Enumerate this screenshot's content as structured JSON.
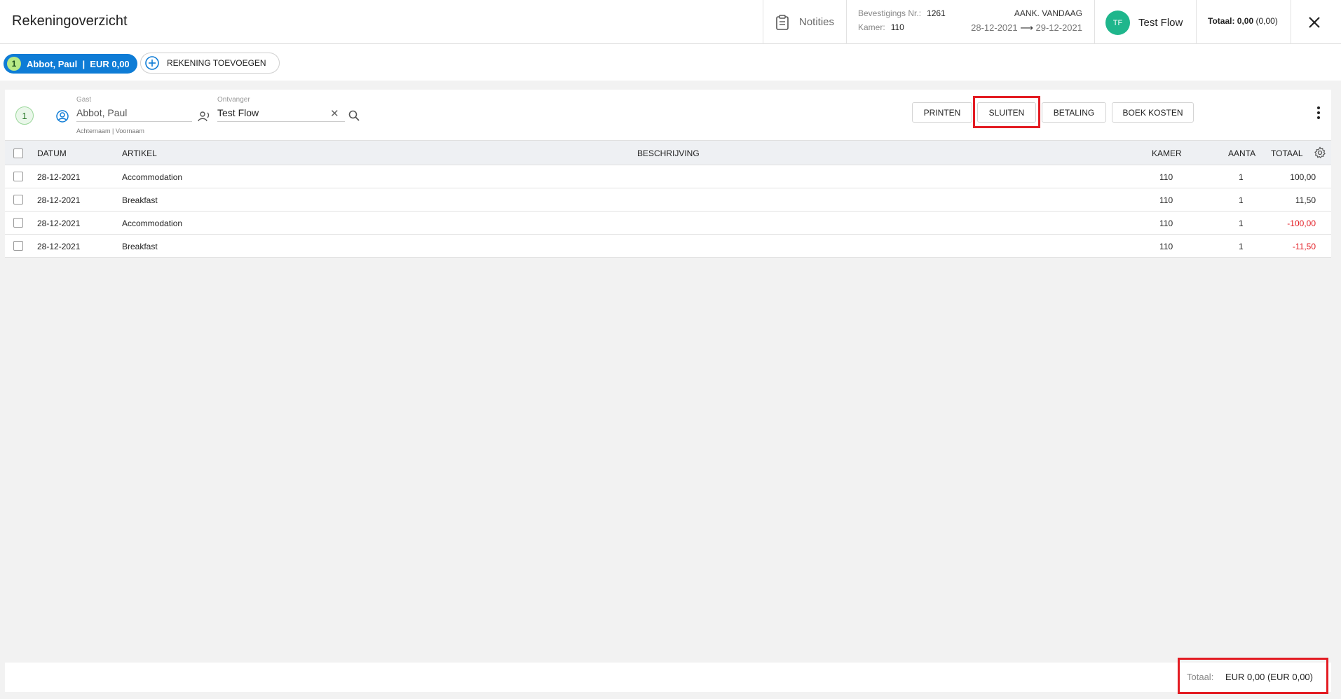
{
  "header": {
    "title": "Rekeningoverzicht",
    "notes_label": "Notities",
    "booking_label": "Bevestigings Nr.:",
    "booking_number": "1261",
    "room_label": "Kamer:",
    "room_number": "110",
    "arrival_status": "AANK. VANDAAG",
    "date_from": "28-12-2021",
    "date_arrow": "⟶",
    "date_to": "29-12-2021",
    "user_initials": "TF",
    "user_name": "Test Flow",
    "total_label": "Totaal:",
    "total_value": "0,00",
    "total_secondary": "(0,00)"
  },
  "accounts": {
    "active": {
      "number": "1",
      "label": "Abbot, Paul  |  EUR 0,00"
    },
    "add_label": "REKENING TOEVOEGEN"
  },
  "panel": {
    "number": "1",
    "guest_label": "Gast",
    "guest_value": "Abbot, Paul",
    "guest_hint": "Achternaam | Voornaam",
    "receiver_label": "Ontvanger",
    "receiver_value": "Test Flow",
    "buttons": {
      "print": "PRINTEN",
      "close": "SLUITEN",
      "payment": "BETALING",
      "book_costs": "BOEK KOSTEN"
    }
  },
  "table": {
    "columns": {
      "date": "DATUM",
      "article": "ARTIKEL",
      "description": "BESCHRIJVING",
      "room": "KAMER",
      "qty": "AANTA",
      "total": "TOTAAL"
    },
    "rows": [
      {
        "date": "28-12-2021",
        "article": "Accommodation",
        "description": "",
        "room": "110",
        "qty": "1",
        "total": "100,00",
        "negative": false
      },
      {
        "date": "28-12-2021",
        "article": "Breakfast",
        "description": "",
        "room": "110",
        "qty": "1",
        "total": "11,50",
        "negative": false
      },
      {
        "date": "28-12-2021",
        "article": "Accommodation",
        "description": "",
        "room": "110",
        "qty": "1",
        "total": "-100,00",
        "negative": true
      },
      {
        "date": "28-12-2021",
        "article": "Breakfast",
        "description": "",
        "room": "110",
        "qty": "1",
        "total": "-11,50",
        "negative": true
      }
    ]
  },
  "footer": {
    "total_label": "Totaal:",
    "total_value": "EUR 0,00 (EUR 0,00)"
  },
  "colors": {
    "accent_blue": "#0e7cd6",
    "avatar_green": "#1fb68c",
    "negative_red": "#e31c23",
    "highlight_red": "#e31c23"
  },
  "icons": {
    "notes": "clipboard-icon",
    "close": "close-icon",
    "add": "plus-circle-icon",
    "guest": "user-circle-icon",
    "receiver": "receiver-icon",
    "clear": "clear-icon",
    "search": "search-icon",
    "more": "more-vertical-icon",
    "settings": "gear-icon"
  }
}
